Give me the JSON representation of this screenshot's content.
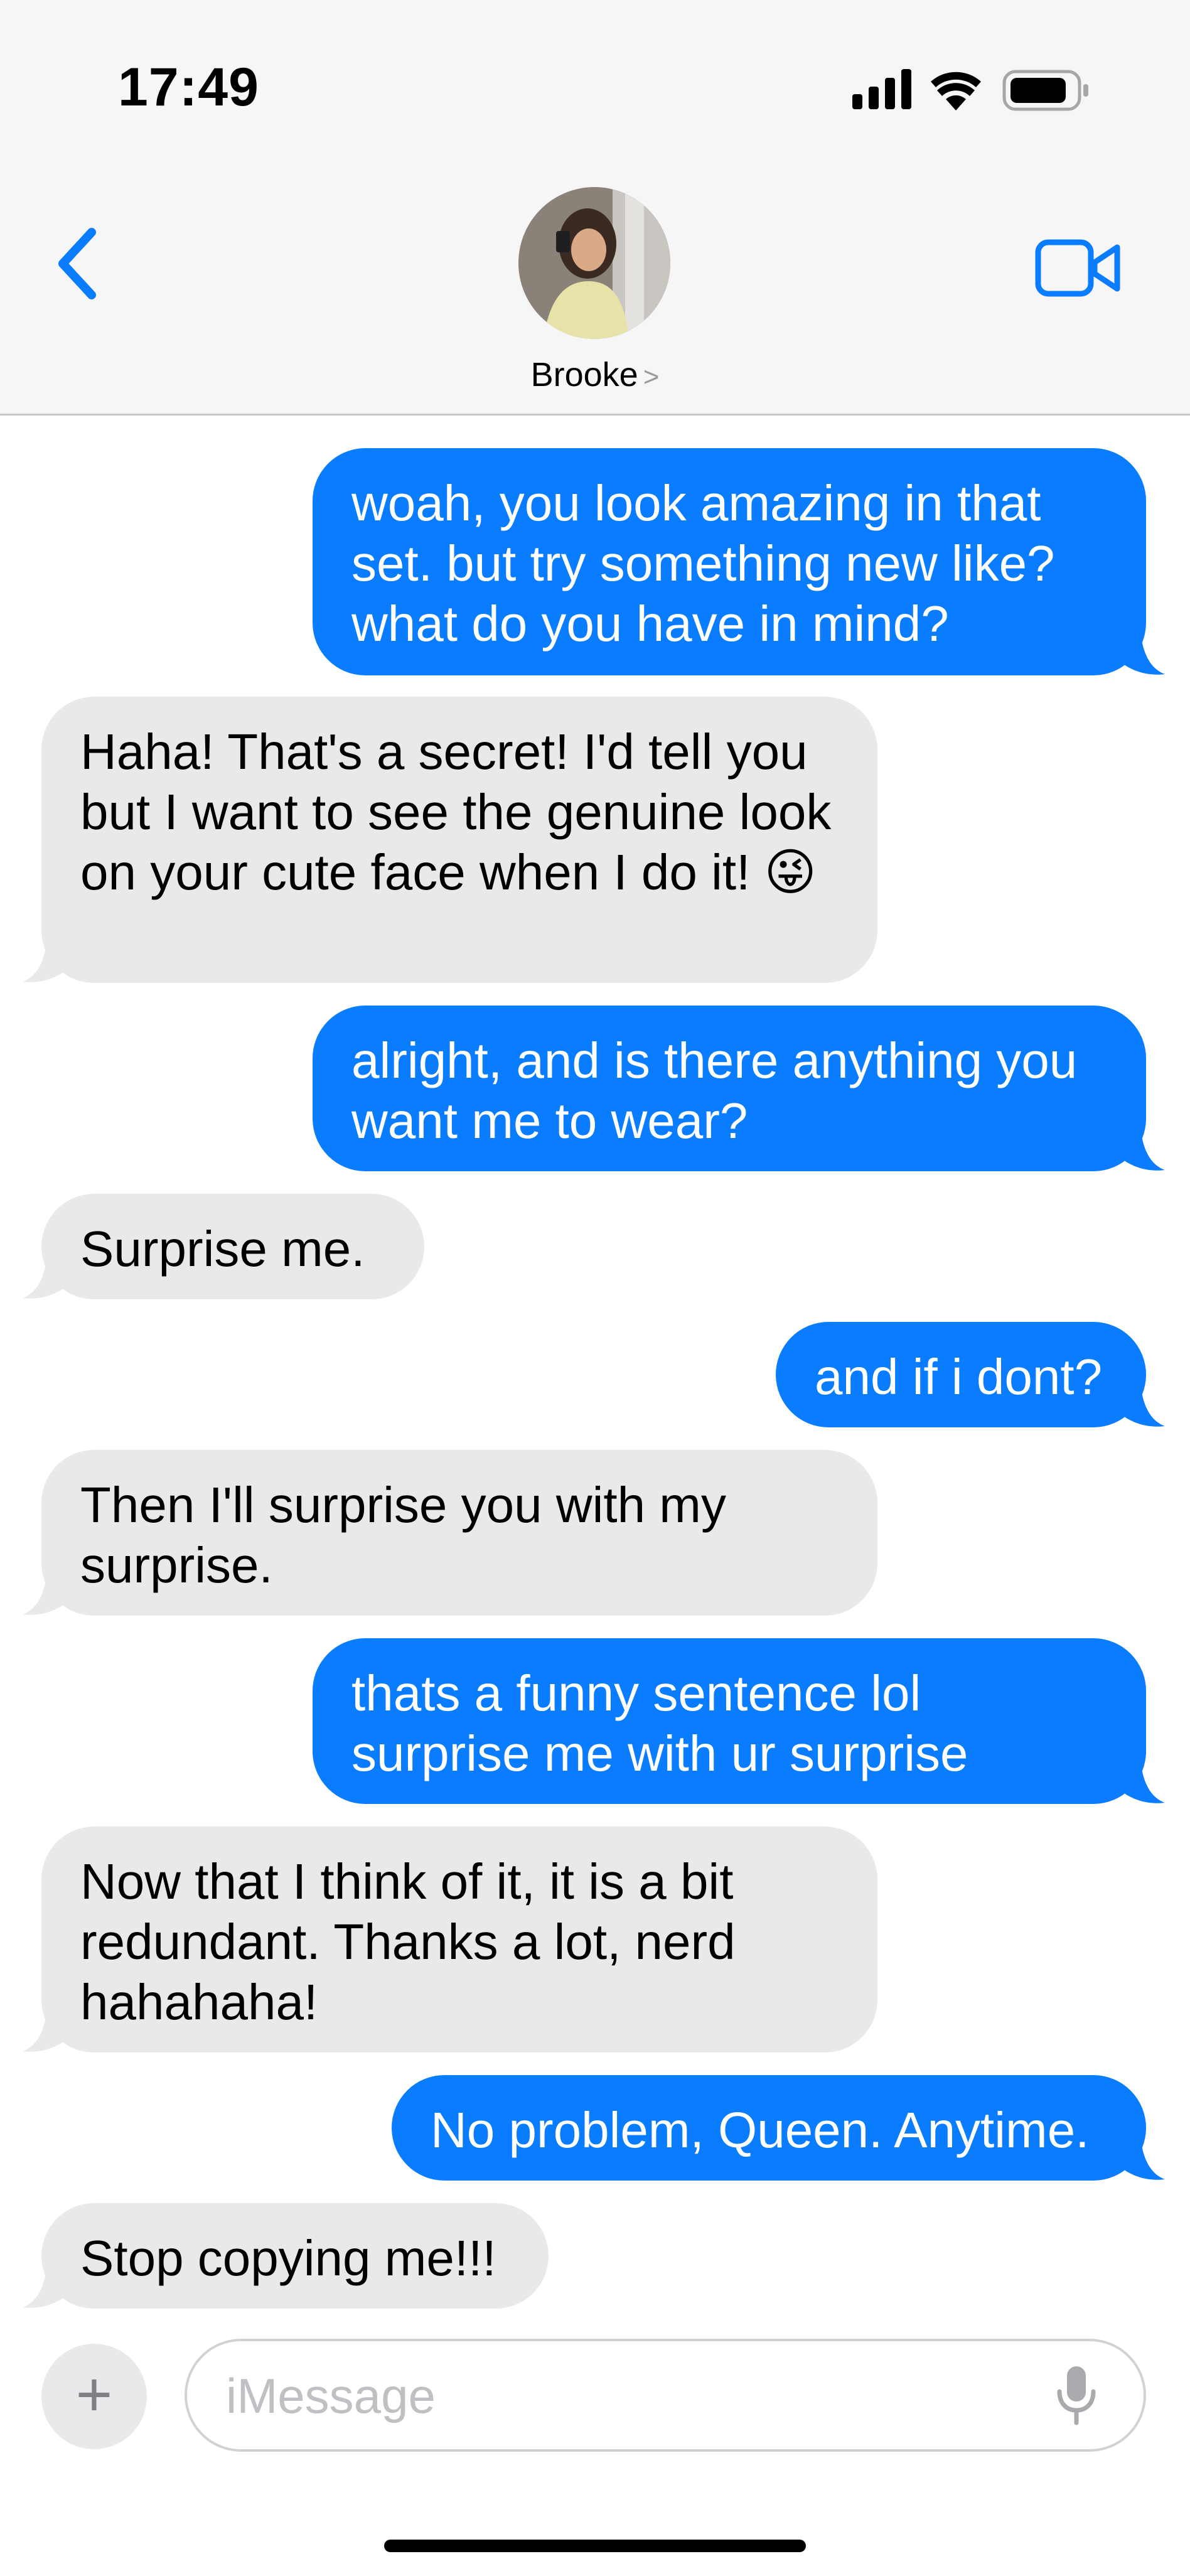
{
  "status_bar": {
    "time": "17:49",
    "icons": [
      "signal-icon",
      "wifi-icon",
      "battery-icon"
    ]
  },
  "header": {
    "back_icon": "chevron-left-icon",
    "contact_name": "Brooke",
    "contact_chevron": ">",
    "video_icon": "video-camera-icon",
    "accent_color": "#0a7cff"
  },
  "messages": [
    {
      "from": "me",
      "text": "woah, you look amazing in that set. but try something new like? what do you have in mind?"
    },
    {
      "from": "them",
      "text": "Haha! That's a secret! I'd tell you but I want to see the genuine look on your cute face when I do it! 😜"
    },
    {
      "from": "me",
      "text": "alright, and is there anything you want me to wear?"
    },
    {
      "from": "them",
      "text": "Surprise me."
    },
    {
      "from": "me",
      "text": "and if i dont?"
    },
    {
      "from": "them",
      "text": "Then I'll surprise you with my surprise."
    },
    {
      "from": "me",
      "text": "thats a funny sentence lol surprise me with ur surprise"
    },
    {
      "from": "them",
      "text": "Now that I think of it, it is a bit redundant. Thanks a lot, nerd hahahaha!"
    },
    {
      "from": "me",
      "text": "No problem, Queen. Anytime."
    },
    {
      "from": "them",
      "text": "Stop copying me!!!"
    }
  ],
  "composer": {
    "plus_label": "+",
    "placeholder": "iMessage",
    "mic_icon": "microphone-icon"
  },
  "colors": {
    "outgoing_bubble": "#0a7cff",
    "incoming_bubble": "#e9e9eb"
  }
}
